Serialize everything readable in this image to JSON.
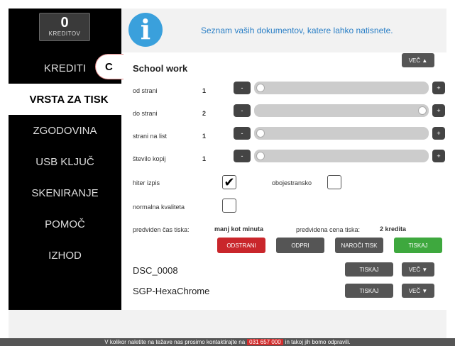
{
  "sidebar": {
    "credits_value": "0",
    "credits_label": "KREDITOV",
    "items": [
      {
        "label": "KREDITI"
      },
      {
        "label": "VRSTA ZA TISK"
      },
      {
        "label": "ZGODOVINA"
      },
      {
        "label": "USB KLJUČ"
      },
      {
        "label": "SKENIRANJE"
      },
      {
        "label": "POMOČ"
      },
      {
        "label": "IZHOD"
      }
    ]
  },
  "callout": "C",
  "info": {
    "icon": "info-icon",
    "glyph": "i",
    "text": "Seznam vaših dokumentov, katere lahko natisnete."
  },
  "section": {
    "title": "School work",
    "more_label": "VEČ ▲",
    "rows": [
      {
        "label": "od strani",
        "value": "1",
        "minus": "-",
        "plus": "+",
        "fill": 0.0
      },
      {
        "label": "do strani",
        "value": "2",
        "minus": "-",
        "plus": "+",
        "fill": 1.0
      },
      {
        "label": "strani na list",
        "value": "1",
        "minus": "-",
        "plus": "+",
        "fill": 0.0
      },
      {
        "label": "število kopij",
        "value": "1",
        "minus": "-",
        "plus": "+",
        "fill": 0.0
      }
    ],
    "options": {
      "fast_print": {
        "label": "hiter izpis",
        "checked": true,
        "mark": "✔"
      },
      "duplex": {
        "label": "obojestransko",
        "checked": false
      },
      "normal_quality": {
        "label": "normalna kvaliteta",
        "checked": false
      }
    },
    "estimate_time_label": "predviden čas tiska:",
    "estimate_time_value": "manj kot minuta",
    "estimate_price_label": "predvidena cena tiska:",
    "estimate_price_value": "2 kredita",
    "actions": [
      {
        "label": "ODSTRANI",
        "color": "#c9262b"
      },
      {
        "label": "ODPRI",
        "color": "#555555"
      },
      {
        "label": "NAROČI TISK",
        "color": "#555555"
      },
      {
        "label": "TISKAJ",
        "color": "#3ea83e"
      }
    ]
  },
  "documents": [
    {
      "name": "DSC_0008",
      "print_label": "TISKAJ",
      "more_label": "VEČ ▼"
    },
    {
      "name": "SGP-HexaChrome",
      "print_label": "TISKAJ",
      "more_label": "VEČ ▼"
    }
  ],
  "footer": {
    "text_before": "V kolikor naletite na težave nas prosimo kontaktirajte na",
    "phone": "031 657 000",
    "text_after": "in takoj jih bomo odpravili."
  }
}
